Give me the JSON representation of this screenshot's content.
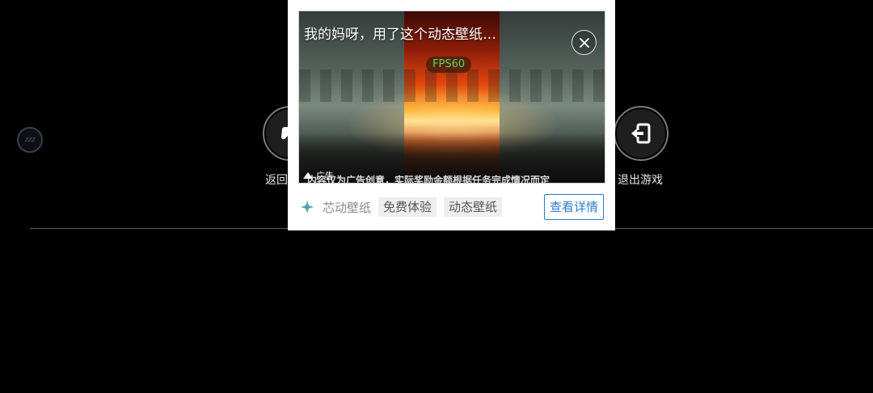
{
  "sleep_button": {
    "label": "zzz"
  },
  "left_action": {
    "label": "返回",
    "icon": "gamepad-icon"
  },
  "right_action": {
    "label": "退出游戏",
    "icon": "exit-icon"
  },
  "ad": {
    "title": "我的妈呀，用了这个动态壁纸…",
    "fps_badge": "FPS60",
    "ad_tag": "广告",
    "caption": "内容仅为广告创意，实际奖励金额根据任务完成情况而定",
    "brand_name": "芯动壁纸",
    "chips": [
      "免费体验",
      "动态壁纸"
    ],
    "cta_label": "查看详情",
    "colors": {
      "cta": "#2f7bd0",
      "fps_text": "#59d36a"
    }
  }
}
